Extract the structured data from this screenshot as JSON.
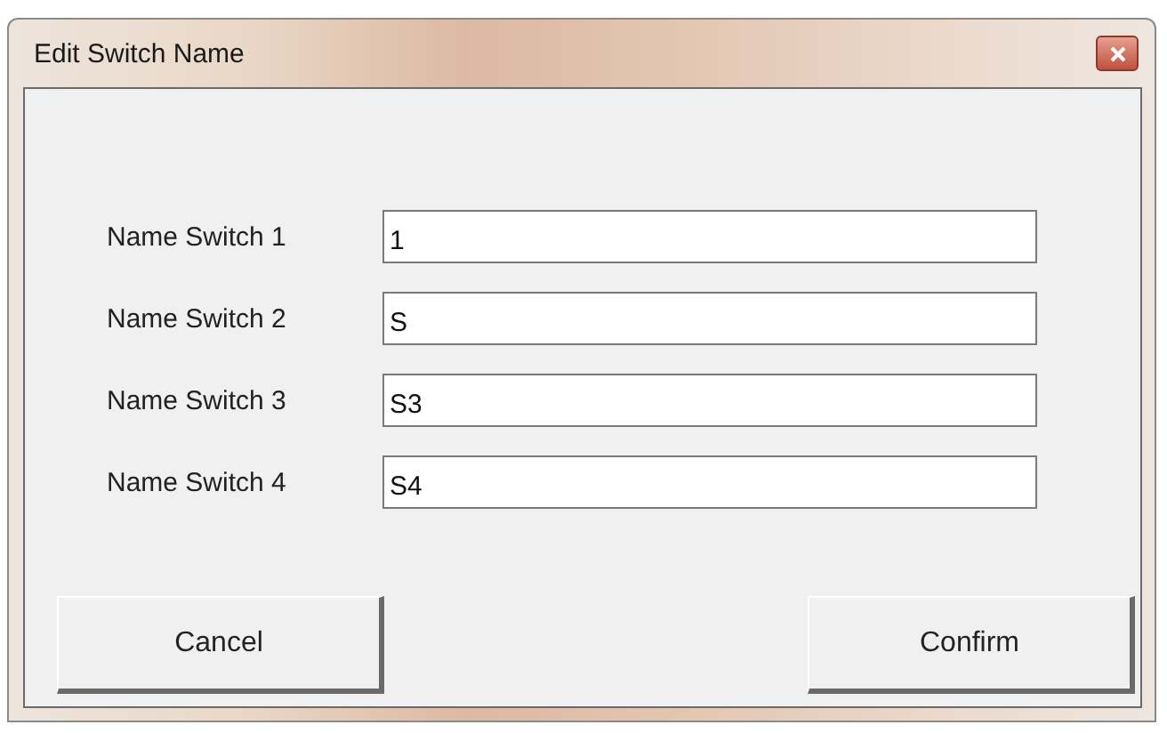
{
  "window": {
    "title": "Edit Switch Name"
  },
  "fields": [
    {
      "label": "Name Switch 1",
      "value": "1"
    },
    {
      "label": "Name Switch 2",
      "value": "S"
    },
    {
      "label": "Name Switch 3",
      "value": "S3"
    },
    {
      "label": "Name Switch 4",
      "value": "S4"
    }
  ],
  "buttons": [
    "Cancel",
    "Confirm"
  ]
}
